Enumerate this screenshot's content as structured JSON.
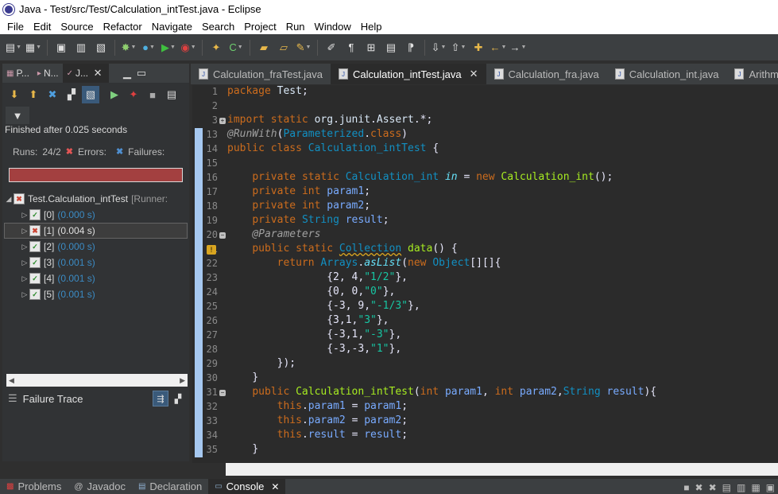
{
  "window": {
    "title": "Java - Test/src/Test/Calculation_intTest.java - Eclipse"
  },
  "menu": [
    "File",
    "Edit",
    "Source",
    "Refactor",
    "Navigate",
    "Search",
    "Project",
    "Run",
    "Window",
    "Help"
  ],
  "left_panel": {
    "tabs": [
      {
        "label": "P...",
        "icon": "package-explorer-icon"
      },
      {
        "label": "N...",
        "icon": "navigator-icon"
      },
      {
        "label": "J...",
        "icon": "junit-icon"
      }
    ],
    "status": "Finished after 0.025 seconds",
    "runs_label": "Runs:",
    "runs_value": "24/2",
    "errors_label": "Errors:",
    "failures_label": "Failures:",
    "progress_color": "#a34040",
    "tree_root": {
      "name": "Test.Calculation_intTest",
      "runner": "[Runner:"
    },
    "tree_items": [
      {
        "name": "[0]",
        "time": "(0.000 s)"
      },
      {
        "name": "[1]",
        "time": "(0.004 s)",
        "selected": true
      },
      {
        "name": "[2]",
        "time": "(0.000 s)"
      },
      {
        "name": "[3]",
        "time": "(0.001 s)"
      },
      {
        "name": "[4]",
        "time": "(0.001 s)"
      },
      {
        "name": "[5]",
        "time": "(0.001 s)"
      }
    ],
    "failure_trace_label": "Failure Trace"
  },
  "editor_tabs": [
    {
      "label": "Calculation_fraTest.java",
      "active": false
    },
    {
      "label": "Calculation_intTest.java",
      "active": true
    },
    {
      "label": "Calculation_fra.java",
      "active": false
    },
    {
      "label": "Calculation_int.java",
      "active": false
    },
    {
      "label": "Arithm",
      "active": false
    }
  ],
  "code_lines": [
    {
      "num": "1",
      "text": "package Test;"
    },
    {
      "num": "2",
      "text": ""
    },
    {
      "num": "3",
      "text": "import static org.junit.Assert.*;"
    },
    {
      "num": "13",
      "text": "@RunWith(Parameterized.class)"
    },
    {
      "num": "14",
      "text": "public class Calculation_intTest {"
    },
    {
      "num": "15",
      "text": ""
    },
    {
      "num": "16",
      "text": "    private static Calculation_int in = new Calculation_int();"
    },
    {
      "num": "17",
      "text": "    private int param1;"
    },
    {
      "num": "18",
      "text": "    private int param2;"
    },
    {
      "num": "19",
      "text": "    private String result;"
    },
    {
      "num": "20",
      "text": "    @Parameters"
    },
    {
      "num": "21",
      "text": "    public static Collection data() {"
    },
    {
      "num": "22",
      "text": "        return Arrays.asList(new Object[][]{"
    },
    {
      "num": "23",
      "text": "                {2, 4,\"1/2\"},"
    },
    {
      "num": "24",
      "text": "                {0, 0,\"0\"},"
    },
    {
      "num": "25",
      "text": "                {-3, 9,\"-1/3\"},"
    },
    {
      "num": "26",
      "text": "                {3,1,\"3\"},"
    },
    {
      "num": "27",
      "text": "                {-3,1,\"-3\"},"
    },
    {
      "num": "28",
      "text": "                {-3,-3,\"1\"},"
    },
    {
      "num": "29",
      "text": "        });"
    },
    {
      "num": "30",
      "text": "    }"
    },
    {
      "num": "31",
      "text": "    public Calculation_intTest(int param1, int param2,String result){"
    },
    {
      "num": "32",
      "text": "        this.param1 = param1;"
    },
    {
      "num": "33",
      "text": "        this.param2 = param2;"
    },
    {
      "num": "34",
      "text": "        this.result = result;"
    },
    {
      "num": "35",
      "text": "    }"
    }
  ],
  "bottom_tabs": [
    {
      "label": "Problems",
      "active": false
    },
    {
      "label": "Javadoc",
      "active": false
    },
    {
      "label": "Declaration",
      "active": false
    },
    {
      "label": "Console",
      "active": true
    }
  ],
  "colors": {
    "editor_bg": "#2b2b2b",
    "keyword": "#cc6c1d",
    "class": "#1290c3",
    "method": "#a7ec21",
    "string": "#17c6a3"
  }
}
